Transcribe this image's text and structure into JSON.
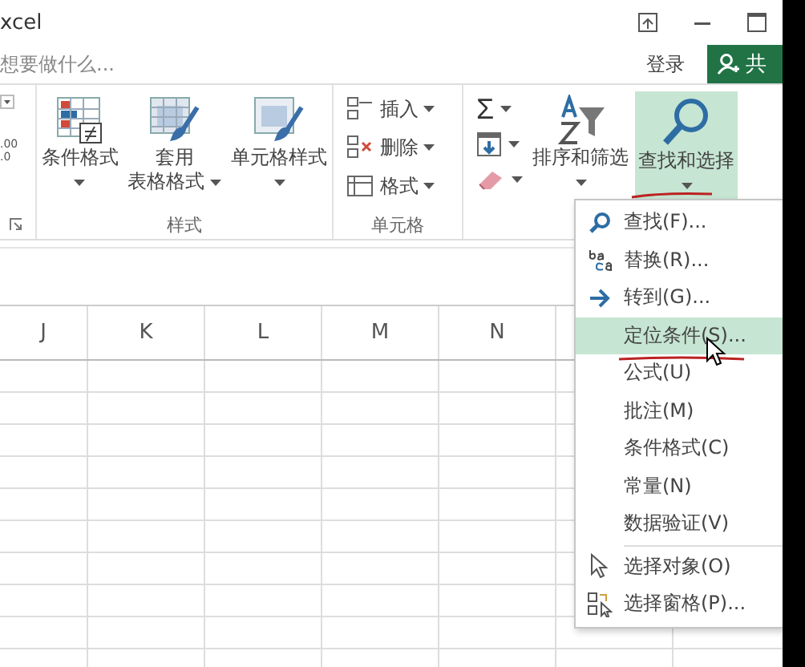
{
  "window": {
    "title": "xcel"
  },
  "tell_me": {
    "placeholder": "想要做什么..."
  },
  "account": {
    "sign_in": "登录",
    "share": "共"
  },
  "ribbon": {
    "number_format_partial": ".00\n.0",
    "styles": {
      "label": "样式",
      "buttons": [
        {
          "kind": "conditional",
          "lines": [
            "条件格式"
          ]
        },
        {
          "kind": "table",
          "lines": [
            "套用",
            "表格格式"
          ]
        },
        {
          "kind": "cellstyle",
          "lines": [
            "单元格样式"
          ]
        }
      ]
    },
    "cells": {
      "label": "单元格",
      "items": [
        {
          "kind": "insert",
          "label": "插入"
        },
        {
          "kind": "delete",
          "label": "删除"
        },
        {
          "kind": "format",
          "label": "格式"
        }
      ]
    },
    "editing": {
      "small": [
        {
          "kind": "sum",
          "label": "Σ"
        },
        {
          "kind": "fill"
        },
        {
          "kind": "clear"
        }
      ],
      "buttons": [
        {
          "kind": "sort",
          "label": "排序和筛选",
          "selected": false
        },
        {
          "kind": "find",
          "label": "查找和选择",
          "selected": true
        }
      ]
    }
  },
  "columns": [
    "J",
    "K",
    "L",
    "M",
    "N"
  ],
  "menu": {
    "items": [
      {
        "kind": "find",
        "label": "查找(F)...",
        "selected": false
      },
      {
        "kind": "replace",
        "label": "替换(R)...",
        "selected": false
      },
      {
        "kind": "goto",
        "label": "转到(G)...",
        "selected": false
      },
      {
        "kind": "plain",
        "label": "定位条件(S)...",
        "selected": true
      },
      {
        "kind": "plain",
        "label": "公式(U)",
        "selected": false
      },
      {
        "kind": "plain",
        "label": "批注(M)",
        "selected": false
      },
      {
        "kind": "plain",
        "label": "条件格式(C)",
        "selected": false
      },
      {
        "kind": "plain",
        "label": "常量(N)",
        "selected": false
      },
      {
        "kind": "plain",
        "label": "数据验证(V)",
        "selected": false
      },
      {
        "kind": "separator"
      },
      {
        "kind": "select",
        "label": "选择对象(O)",
        "selected": false
      },
      {
        "kind": "pane",
        "label": "选择窗格(P)...",
        "selected": false
      }
    ]
  }
}
